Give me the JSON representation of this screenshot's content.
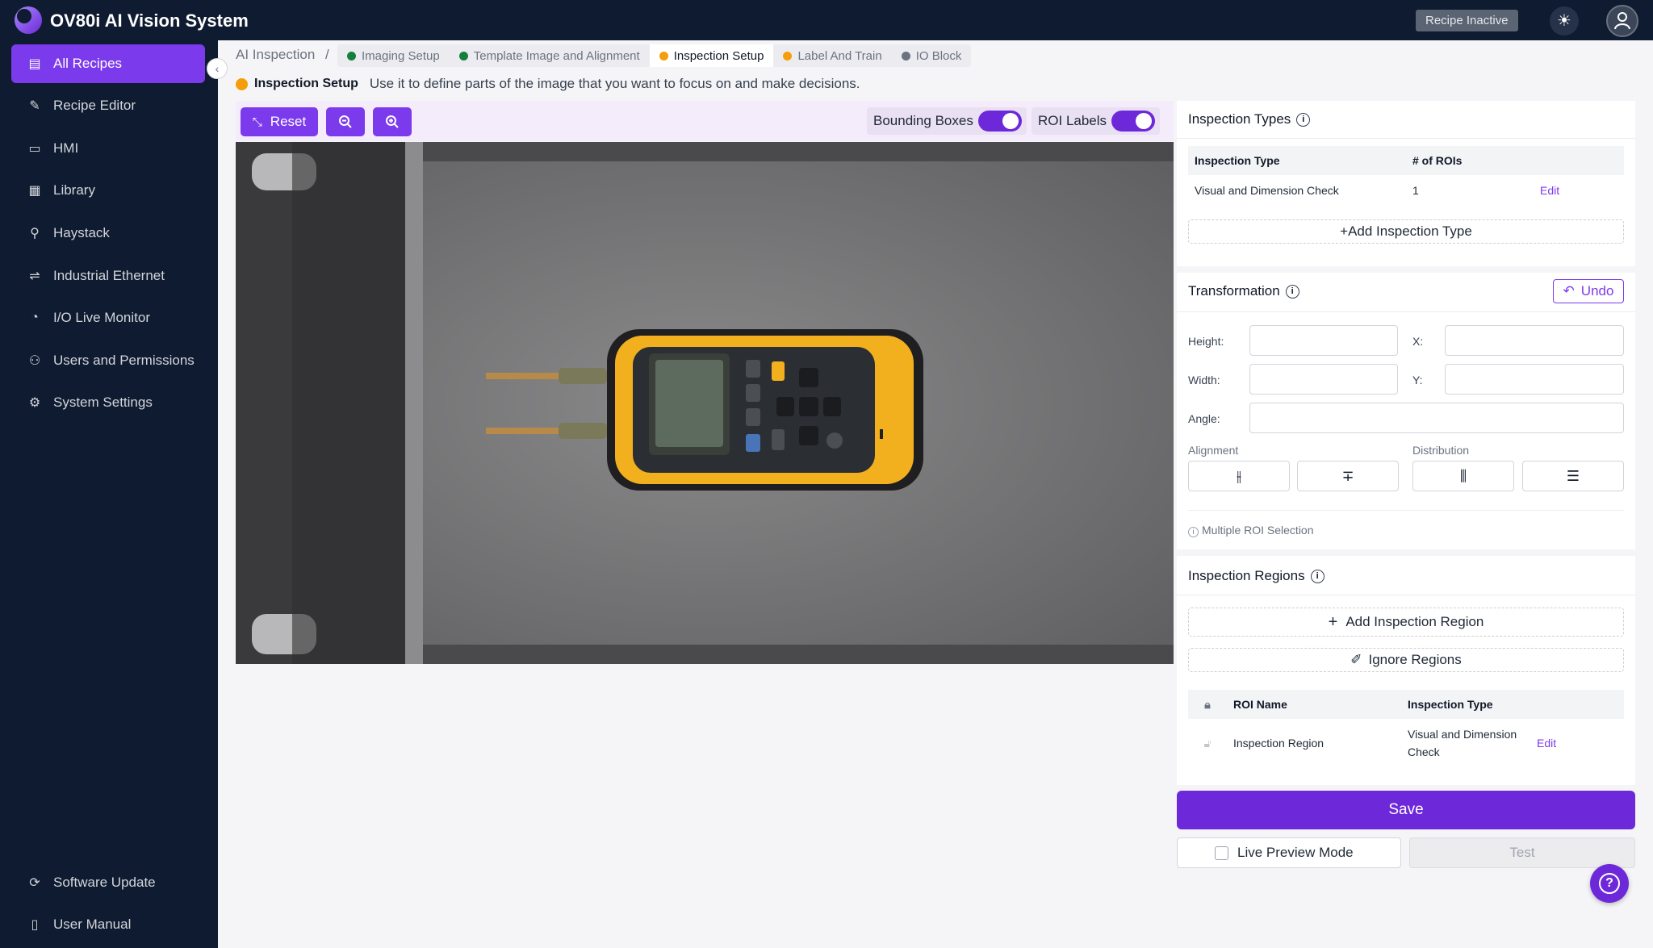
{
  "app": {
    "title": "OV80i AI Vision System",
    "recipe_status": "Recipe Inactive"
  },
  "icons": {
    "theme": "sun-icon",
    "user": "user-icon"
  },
  "sidebar": {
    "items": [
      {
        "label": "All Recipes",
        "icon": "file-icon",
        "active": true
      },
      {
        "label": "Recipe Editor",
        "icon": "pencil-icon"
      },
      {
        "label": "HMI",
        "icon": "video-icon"
      },
      {
        "label": "Library",
        "icon": "grid-icon"
      },
      {
        "label": "Haystack",
        "icon": "search-icon"
      },
      {
        "label": "Industrial Ethernet",
        "icon": "network-icon"
      },
      {
        "label": "I/O Live Monitor",
        "icon": "monitor-icon"
      },
      {
        "label": "Users and Permissions",
        "icon": "user-icon"
      },
      {
        "label": "System Settings",
        "icon": "gear-icon"
      }
    ],
    "bottom": [
      {
        "label": "Software Update",
        "icon": "refresh-icon"
      },
      {
        "label": "User Manual",
        "icon": "book-icon"
      }
    ]
  },
  "breadcrumb": {
    "root": "AI Inspection",
    "separator": "/",
    "steps": [
      {
        "label": "Imaging Setup",
        "color": "#15803d"
      },
      {
        "label": "Template Image and Alignment",
        "color": "#15803d"
      },
      {
        "label": "Inspection Setup",
        "color": "#f59e0b",
        "active": true
      },
      {
        "label": "Label And Train",
        "color": "#f59e0b"
      },
      {
        "label": "IO Block",
        "color": "#6b7280"
      }
    ]
  },
  "info": {
    "step": "Inspection Setup",
    "text": "Use it to define parts of the image that you want to focus on and make decisions."
  },
  "toolbar": {
    "reset": "Reset",
    "bounding_boxes": "Bounding Boxes",
    "roi_labels": "ROI Labels"
  },
  "inspection_types": {
    "title": "Inspection Types",
    "headers": [
      "Inspection Type",
      "# of ROIs"
    ],
    "rows": [
      {
        "type": "Visual and Dimension Check",
        "count": "1",
        "action": "Edit"
      }
    ],
    "add_label": "+Add Inspection Type"
  },
  "transformation": {
    "title": "Transformation",
    "undo": "Undo",
    "height": "Height:",
    "width": "Width:",
    "angle": "Angle:",
    "x": "X:",
    "y": "Y:",
    "alignment": "Alignment",
    "distribution": "Distribution",
    "multi_note": "Multiple ROI Selection"
  },
  "inspection_regions": {
    "title": "Inspection Regions",
    "add_label": "Add Inspection Region",
    "ignore_label": "Ignore Regions",
    "headers": [
      "ROI Name",
      "Inspection Type"
    ],
    "rows": [
      {
        "name": "Inspection Region",
        "type": "Visual and Dimension Check",
        "action": "Edit"
      }
    ]
  },
  "actions": {
    "save": "Save",
    "live_preview": "Live Preview Mode",
    "test": "Test"
  }
}
